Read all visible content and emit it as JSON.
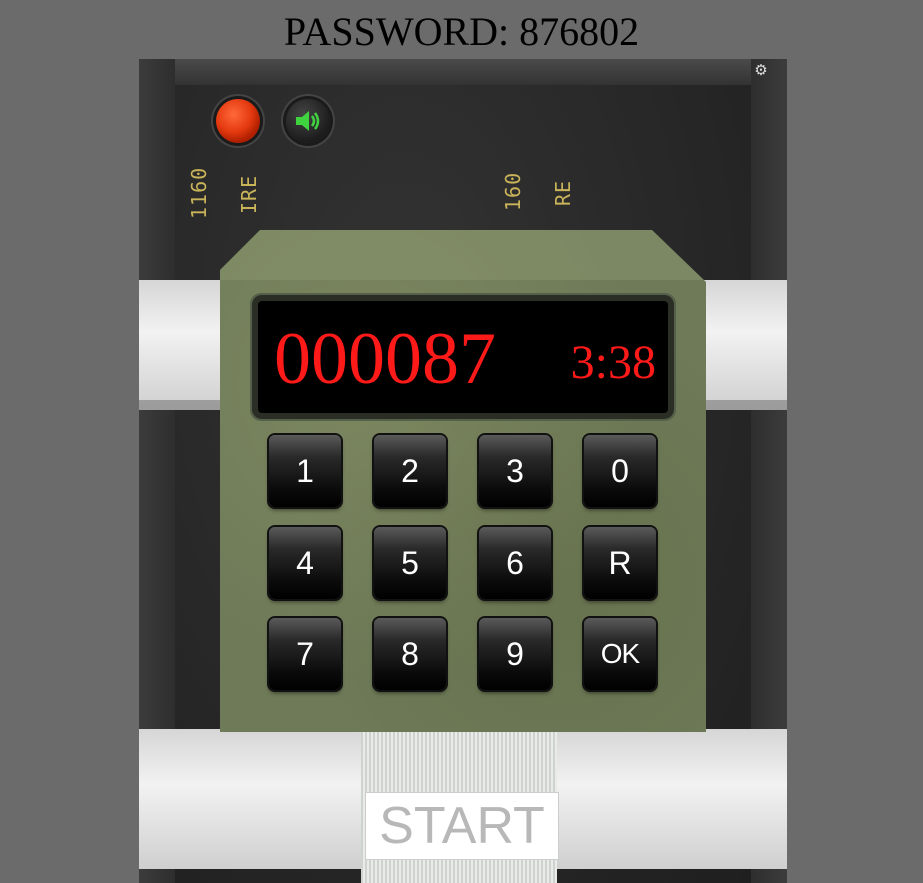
{
  "header": {
    "password_text": "PASSWORD: 876802"
  },
  "controls": {
    "settings_icon": "gear-icon",
    "record_icon": "record-icon",
    "sound_icon": "speaker-icon"
  },
  "wire_labels": [
    "1160",
    "IRE",
    "160",
    "RE"
  ],
  "display": {
    "code": "000087",
    "timer": "3:38"
  },
  "keypad": {
    "rows": [
      [
        "1",
        "2",
        "3",
        "0"
      ],
      [
        "4",
        "5",
        "6",
        "R"
      ],
      [
        "7",
        "8",
        "9",
        "OK"
      ]
    ]
  },
  "start_label": "START",
  "colors": {
    "background": "#6b6b6b",
    "display_text": "#ff1a1a",
    "keypad_body": "#6e7a58",
    "record_button": "#e53a10",
    "sound_icon": "#3fd43f"
  }
}
